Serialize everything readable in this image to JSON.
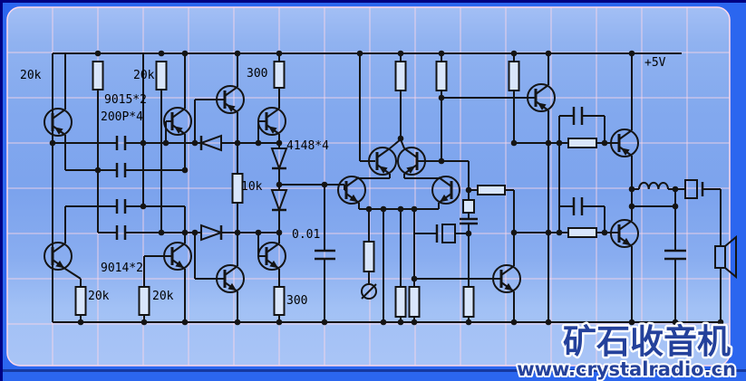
{
  "schematic": {
    "power_label": "+5V",
    "components": {
      "r_top_1": "20k",
      "r_top_2": "20k",
      "transistor_group_top": "9015*2",
      "capacitor_bank": "200P*4",
      "r_collector_top": "300",
      "diode_group": "4148*4",
      "r_mid": "10k",
      "c_coupling": "0.01",
      "transistor_group_bottom": "9014*2",
      "r_bottom_1": "20k",
      "r_bottom_2": "20k",
      "r_collector_bottom": "300"
    }
  },
  "watermark": {
    "title": "矿石收音机",
    "url": "www.crystalradio.cn"
  },
  "colors": {
    "outer_background": "#2b66ef",
    "outer_dark_edge": "#000082",
    "panel_top": "#9fbcf4",
    "panel_middle": "#7ca3ed",
    "panel_bottom": "#aac5f6",
    "grid_line": "#ffd7e6",
    "panel_border": "#ffd9ea",
    "wire": "#141414",
    "watermark_fill": "#24419b",
    "watermark_stroke": "#ffffff"
  }
}
